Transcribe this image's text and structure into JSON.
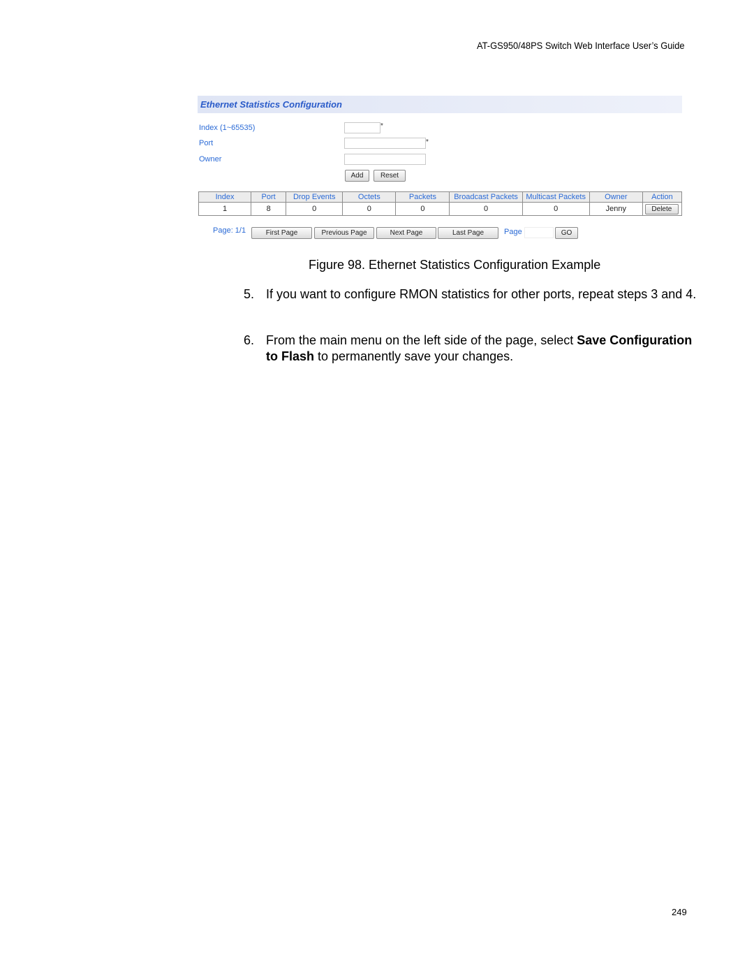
{
  "header": {
    "title": "AT-GS950/48PS Switch Web Interface User’s Guide"
  },
  "figure": {
    "panel_title": "Ethernet Statistics Configuration",
    "form": {
      "index_label": "Index (1~65535)",
      "index_value": "",
      "port_label": "Port",
      "port_value": "",
      "owner_label": "Owner",
      "owner_value": "",
      "required_marker": "*",
      "add_button": "Add",
      "reset_button": "Reset"
    },
    "table": {
      "columns": [
        "Index",
        "Port",
        "Drop Events",
        "Octets",
        "Packets",
        "Broadcast Packets",
        "Multicast Packets",
        "Owner",
        "Action"
      ],
      "rows": [
        {
          "index": "1",
          "port": "8",
          "drop_events": "0",
          "octets": "0",
          "packets": "0",
          "broadcast_packets": "0",
          "multicast_packets": "0",
          "owner": "Jenny",
          "action": "Delete"
        }
      ]
    },
    "pager": {
      "page_status": "Page: 1/1",
      "first_page": "First Page",
      "previous_page": "Previous Page",
      "next_page": "Next Page",
      "last_page": "Last Page",
      "page_label": "Page",
      "page_value": "",
      "go_button": "GO"
    }
  },
  "caption": "Figure 98. Ethernet Statistics Configuration Example",
  "steps": [
    {
      "number": "5.",
      "text": "If you want to configure RMON statistics for other ports, repeat steps 3 and 4."
    },
    {
      "number": "6.",
      "text_before": "From the main menu on the left side of the page, select ",
      "bold": "Save Configuration to Flash",
      "text_after": " to permanently save your changes."
    }
  ],
  "footer": {
    "page_number": "249"
  }
}
